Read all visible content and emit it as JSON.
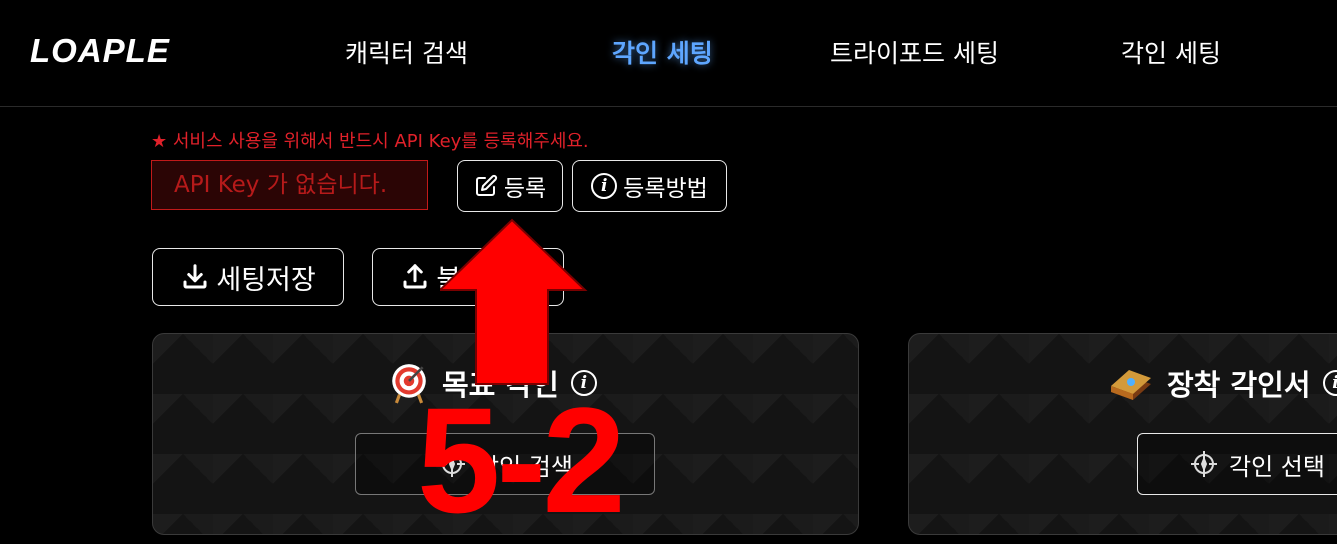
{
  "header": {
    "logo": "LOAPLE",
    "nav": [
      {
        "label": "캐릭터 검색",
        "active": false
      },
      {
        "label": "각인 세팅",
        "active": true
      },
      {
        "label": "트라이포드 세팅",
        "active": false
      },
      {
        "label": "각인 세팅",
        "active": false
      }
    ]
  },
  "api": {
    "warning": "★ 서비스 사용을 위해서 반드시 API Key를 등록해주세요.",
    "status": "API Key 가 없습니다.",
    "register_label": "등록",
    "howto_label": "등록방법"
  },
  "actions": {
    "save_label": "세팅저장",
    "load_label": "불러오기"
  },
  "panels": {
    "target": {
      "title": "목표 각인",
      "button": "각인 검색"
    },
    "equip": {
      "title": "장착 각인서",
      "button": "각인 선택"
    }
  },
  "annotation": {
    "label": "5-2",
    "color": "#ff0000"
  },
  "colors": {
    "accent": "#5ea6ff",
    "warning": "#e0212a"
  }
}
